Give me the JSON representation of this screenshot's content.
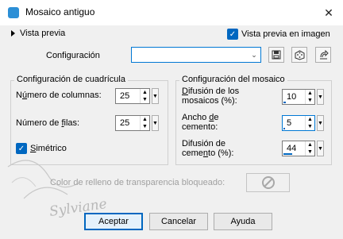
{
  "window": {
    "title": "Mosaico antiguo"
  },
  "preview": {
    "toggle_label": "Vista previa",
    "on_image_label": "Vista previa en imagen"
  },
  "config": {
    "label": "Configuración",
    "value": ""
  },
  "grid": {
    "title": "Configuración de cuadrícula",
    "columns": {
      "label_pre": "N",
      "label_accel": "ú",
      "label_post": "mero de columnas:",
      "value": "25"
    },
    "rows": {
      "label_pre": "Número de ",
      "label_accel": "f",
      "label_post": "ilas:",
      "value": "25"
    },
    "symmetric": {
      "label_pre": "",
      "label_accel": "S",
      "label_post": "imétrico"
    }
  },
  "mosaic": {
    "title": "Configuración del mosaico",
    "diffusion": {
      "line1_accel": "D",
      "line1_rest": "ifusión de los",
      "line2": "mosaicos (%):",
      "value": "10",
      "level": 0.1
    },
    "cement_width": {
      "line1_pre": "Ancho ",
      "line1_accel": "d",
      "line1_post": "e",
      "line2": "cemento:",
      "value": "5",
      "level": 0.05
    },
    "cement_diffusion": {
      "line1": "Difusión de",
      "line2_pre": "ceme",
      "line2_accel": "n",
      "line2_post": "to (%):",
      "value": "44",
      "level": 0.44
    }
  },
  "fill": {
    "label": "Color de relleno de transparencia bloqueado:"
  },
  "watermark": {
    "text": "Sylviane"
  },
  "buttons": {
    "accept": "Aceptar",
    "cancel": "Cancelar",
    "help": "Ayuda"
  }
}
